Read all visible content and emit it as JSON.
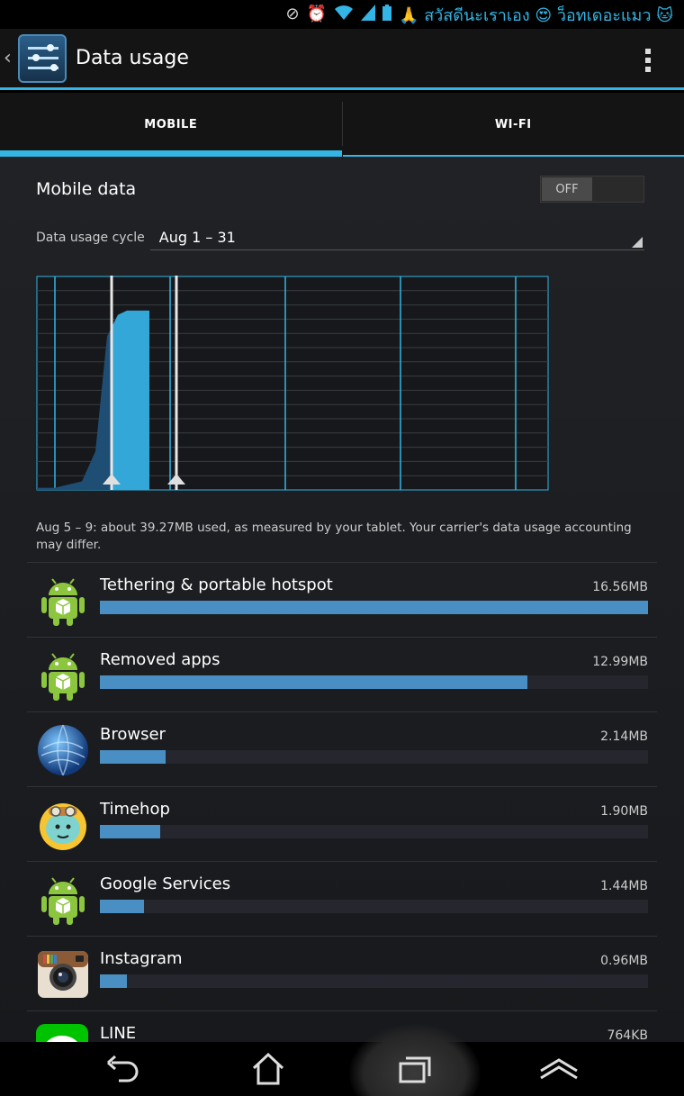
{
  "status_bar": {
    "icons": [
      "mute-icon",
      "alarm-icon",
      "wifi-icon",
      "signal-icon",
      "battery-icon"
    ],
    "notification_text": "🙏 สวัสดีนะเราเอง 😍 ว็อทเดอะแมว 🐱"
  },
  "action_bar": {
    "title": "Data usage",
    "app_icon": "settings-sliders-icon",
    "menu_icon": "overflow-menu-icon"
  },
  "tabs": [
    {
      "label": "MOBILE",
      "selected": true
    },
    {
      "label": "WI-FI",
      "selected": false
    }
  ],
  "mobile_data": {
    "label": "Mobile data",
    "toggle_label": "OFF",
    "enabled": false
  },
  "cycle": {
    "label": "Data usage cycle",
    "value": "Aug 1 – 31"
  },
  "summary": "Aug 5 – 9: about 39.27MB used, as measured by your tablet. Your carrier's data usage accounting may differ.",
  "chart_data": {
    "type": "area",
    "x_range": [
      "Aug 1",
      "Aug 31"
    ],
    "gridlines": true,
    "selection_start_day": 5,
    "selection_end_day": 9,
    "cumulative_level_fraction": [
      0.01,
      0.01,
      0.04,
      0.18,
      0.72,
      0.82,
      0.84,
      0.84
    ]
  },
  "apps": [
    {
      "name": "Tethering & portable hotspot",
      "size": "16.56MB",
      "icon": "android-icon",
      "fraction": 1.0
    },
    {
      "name": "Removed apps",
      "size": "12.99MB",
      "icon": "android-icon",
      "fraction": 0.78
    },
    {
      "name": "Browser",
      "size": "2.14MB",
      "icon": "globe-icon",
      "fraction": 0.12
    },
    {
      "name": "Timehop",
      "size": "1.90MB",
      "icon": "timehop-dino-icon",
      "fraction": 0.11
    },
    {
      "name": "Google Services",
      "size": "1.44MB",
      "icon": "android-icon",
      "fraction": 0.08
    },
    {
      "name": "Instagram",
      "size": "0.96MB",
      "icon": "instagram-camera-icon",
      "fraction": 0.05
    },
    {
      "name": "LINE",
      "size": "764KB",
      "icon": "line-icon",
      "fraction": 0.04
    }
  ],
  "nav_bar": {
    "buttons": [
      "back-icon",
      "home-icon",
      "recent-apps-icon",
      "menu-up-icon"
    ]
  },
  "colors": {
    "accent": "#33b5e5",
    "bar": "#4a8fc4",
    "android": "#8cc63f"
  }
}
